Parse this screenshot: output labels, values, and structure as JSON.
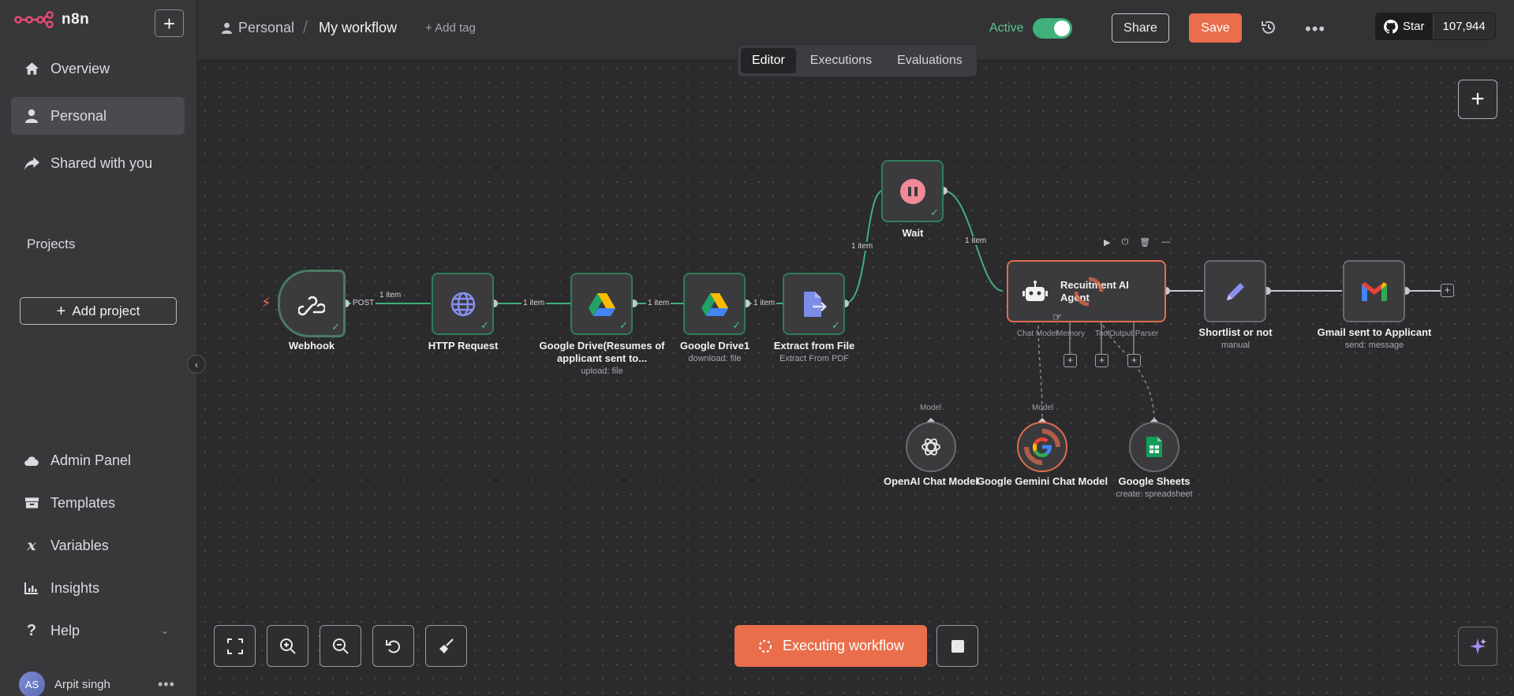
{
  "app": {
    "logo_text": "n8n"
  },
  "sidebar": {
    "new_label": "+",
    "items": [
      {
        "label": "Overview",
        "icon": "home-icon"
      },
      {
        "label": "Personal",
        "icon": "user-icon",
        "active": true
      },
      {
        "label": "Shared with you",
        "icon": "share-icon"
      }
    ],
    "projects_heading": "Projects",
    "add_project": "Add project",
    "bottom_items": [
      {
        "label": "Admin Panel",
        "icon": "cloud-icon"
      },
      {
        "label": "Templates",
        "icon": "box-icon"
      },
      {
        "label": "Variables",
        "icon": "variable-icon"
      },
      {
        "label": "Insights",
        "icon": "chart-icon"
      },
      {
        "label": "Help",
        "icon": "question-icon"
      }
    ],
    "user": {
      "initials": "AS",
      "name": "Arpit singh"
    }
  },
  "header": {
    "breadcrumb_project": "Personal",
    "breadcrumb_separator": "/",
    "workflow_name": "My workflow",
    "add_tag": "+ Add tag",
    "active_label": "Active",
    "share": "Share",
    "save": "Save",
    "star_label": "Star",
    "star_count": "107,944"
  },
  "tabs": [
    "Editor",
    "Executions",
    "Evaluations"
  ],
  "nodes": {
    "webhook": {
      "label": "Webhook"
    },
    "http": {
      "label": "HTTP Request"
    },
    "gdrive": {
      "label": "Google Drive(Resumes of applicant sent to...",
      "sub": "upload: file"
    },
    "gdrive1": {
      "label": "Google Drive1",
      "sub": "download: file"
    },
    "extract": {
      "label": "Extract from File",
      "sub": "Extract From PDF"
    },
    "wait": {
      "label": "Wait"
    },
    "agent": {
      "label": "Recuitment AI Agent"
    },
    "shortlist": {
      "label": "Shortlist or not",
      "sub": "manual"
    },
    "gmail": {
      "label": "Gmail sent to Applicant",
      "sub": "send: message"
    },
    "openai": {
      "label": "OpenAI Chat Model",
      "port": "Model"
    },
    "gemini": {
      "label": "Google Gemini Chat Model",
      "port": "Model"
    },
    "sheets": {
      "label": "Google Sheets",
      "sub": "create: spreadsheet"
    }
  },
  "edges": {
    "post": "POST",
    "item": "1 item"
  },
  "agent_ports": {
    "chat_model": "Chat Model",
    "memory": "Memory",
    "tool": "Tool",
    "output_parser": "Output Parser"
  },
  "controls": {
    "executing": "Executing workflow"
  },
  "colors": {
    "accent": "#ea6e4c",
    "success": "#3fb07a",
    "sidebar": "#38383b",
    "canvas": "#2b2b2e"
  }
}
